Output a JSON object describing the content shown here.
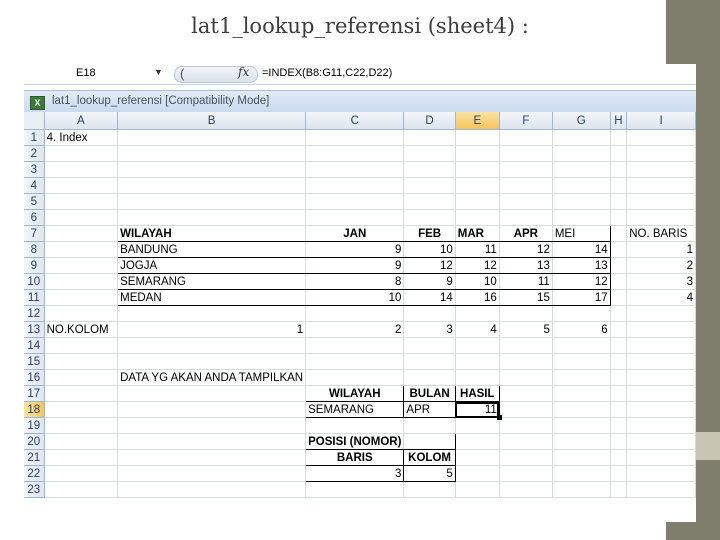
{
  "slide": {
    "title": "lat1_lookup_referensi (sheet4) :"
  },
  "formula_bar": {
    "cell_ref": "E18",
    "fx_label": "fx",
    "formula": "=INDEX(B8:G11,C22,D22)"
  },
  "window": {
    "title": "lat1_lookup_referensi  [Compatibility Mode]"
  },
  "columns": [
    "A",
    "B",
    "C",
    "D",
    "E",
    "F",
    "G",
    "H",
    "I"
  ],
  "rows": [
    "1",
    "2",
    "3",
    "4",
    "5",
    "6",
    "7",
    "8",
    "9",
    "10",
    "11",
    "12",
    "13",
    "14",
    "15",
    "16",
    "17",
    "18",
    "19",
    "20",
    "21",
    "22",
    "23"
  ],
  "sheet": {
    "a1": "4. Index",
    "table_headers": [
      "WILAYAH",
      "JAN",
      "FEB",
      "MAR",
      "APR",
      "MEI"
    ],
    "no_baris_label": "NO. BARIS",
    "table_rows": [
      {
        "wilayah": "BANDUNG",
        "jan": "9",
        "feb": "10",
        "mar": "11",
        "apr": "12",
        "mei": "14",
        "baris": "1"
      },
      {
        "wilayah": "JOGJA",
        "jan": "9",
        "feb": "12",
        "mar": "12",
        "apr": "13",
        "mei": "13",
        "baris": "2"
      },
      {
        "wilayah": "SEMARANG",
        "jan": "8",
        "feb": "9",
        "mar": "10",
        "apr": "11",
        "mei": "12",
        "baris": "3"
      },
      {
        "wilayah": "MEDAN",
        "jan": "10",
        "feb": "14",
        "mar": "16",
        "apr": "15",
        "mei": "17",
        "baris": "4"
      }
    ],
    "no_kolom_label": "NO.KOLOM",
    "no_kolom": [
      "1",
      "2",
      "3",
      "4",
      "5",
      "6"
    ],
    "prompt": "DATA YG AKAN ANDA TAMPILKAN",
    "lookup_headers": [
      "WILAYAH",
      "BULAN",
      "HASIL"
    ],
    "lookup_values": {
      "wilayah": "SEMARANG",
      "bulan": "APR",
      "hasil": "11"
    },
    "posisi_title": "POSISI (NOMOR)",
    "posisi_headers": [
      "BARIS",
      "KOLOM"
    ],
    "posisi_values": [
      "3",
      "5"
    ]
  },
  "colors": {
    "active_header": "#f6c35a",
    "header_bg": "#dde5ef",
    "sidebar": "#7f7d6b"
  },
  "selected_cell": "E18"
}
